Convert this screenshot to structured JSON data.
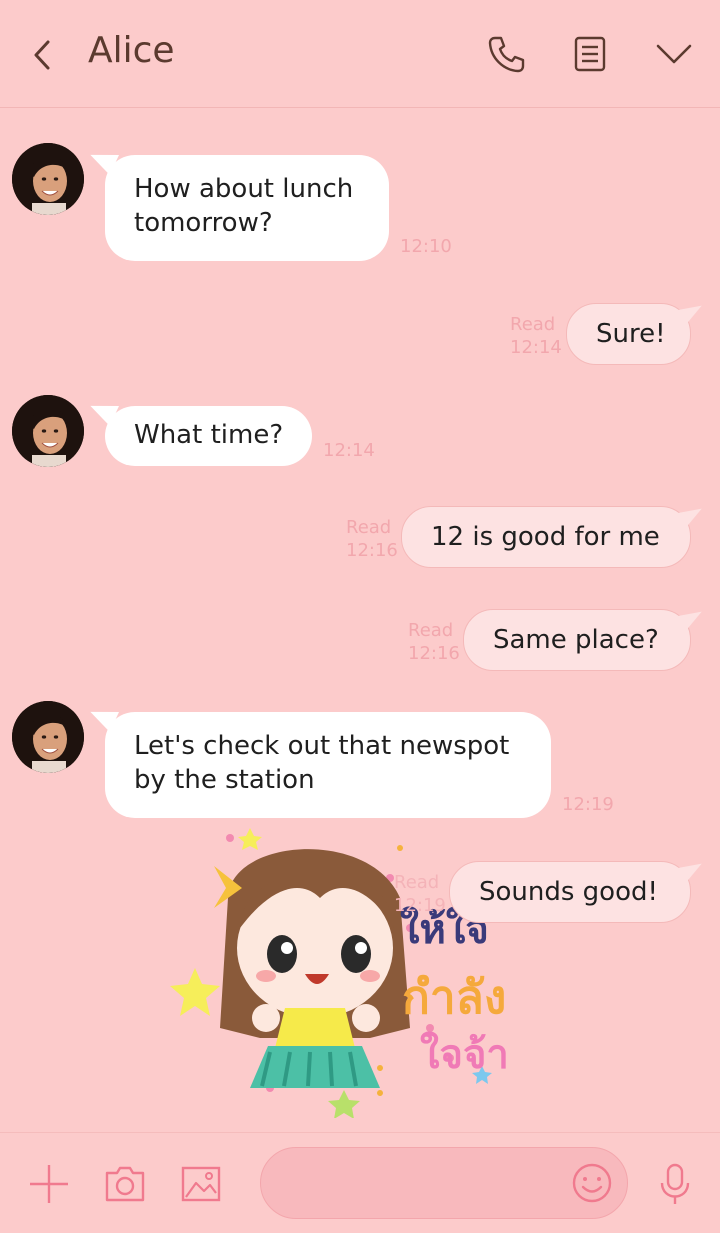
{
  "header": {
    "title": "Alice"
  },
  "messages": [
    {
      "side": "in",
      "text": "How about lunch\ntomorrow?",
      "time": "12:10"
    },
    {
      "side": "out",
      "text": "Sure!",
      "read": "Read",
      "time": "12:14"
    },
    {
      "side": "in",
      "text": "What time?",
      "time": "12:14"
    },
    {
      "side": "out",
      "text": "12 is good for me",
      "read": "Read",
      "time": "12:16"
    },
    {
      "side": "out",
      "text": "Same place?",
      "read": "Read",
      "time": "12:16"
    },
    {
      "side": "in",
      "text": "Let's check out that newspot\nby the station",
      "time": "12:19"
    },
    {
      "side": "out",
      "text": "Sounds good!",
      "read": "Read",
      "time": "12:19"
    }
  ],
  "sticker": {
    "text_lines": [
      "ให้ใจ",
      "กำลัง",
      "ใจจ้า"
    ]
  },
  "icons": {
    "back": "back-chevron-icon",
    "call": "phone-icon",
    "notes": "notes-icon",
    "menu": "chevron-down-icon",
    "add": "plus-icon",
    "camera": "camera-icon",
    "image": "image-icon",
    "emoji": "smiley-icon",
    "mic": "microphone-icon"
  },
  "colors": {
    "background": "#fccbcb",
    "accent": "#f07a8e",
    "title": "#5b3a2f",
    "timestamp": "#f2a7ad"
  }
}
